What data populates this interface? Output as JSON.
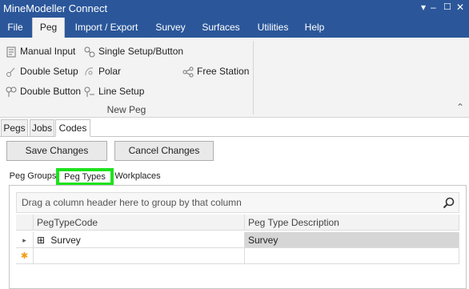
{
  "window": {
    "title": "MineModeller Connect",
    "pin": "▾",
    "pin2": "⊕",
    "minimize": "–",
    "maximize": "☐",
    "close": "✕"
  },
  "menu": {
    "items": [
      "File",
      "Peg",
      "Import / Export",
      "Survey",
      "Surfaces",
      "Utilities",
      "Help"
    ],
    "active": "Peg"
  },
  "ribbon": {
    "items": [
      "Manual Input",
      "Single Setup/Button",
      "Double Setup",
      "Polar",
      "Free Station",
      "Double Button",
      "Line Setup"
    ],
    "group_label": "New Peg",
    "collapse": "⌃"
  },
  "top_tabs": [
    "Pegs",
    "Jobs",
    "Codes"
  ],
  "buttons": {
    "save": "Save Changes",
    "cancel": "Cancel Changes"
  },
  "sub_tabs": [
    "Peg Groups",
    "Peg Types",
    "Workplaces"
  ],
  "grid": {
    "group_hint": "Drag a column header here to group by that column",
    "columns": [
      "PegTypeCode",
      "Peg Type Description"
    ],
    "rows": [
      {
        "code": "Survey",
        "description": "Survey",
        "expand": "⊞",
        "marker": "▸"
      }
    ],
    "new_row_marker": "✱"
  },
  "colors": {
    "title_bar": "#2b579a",
    "highlight": "#1de21d",
    "new_row": "#f39c12"
  }
}
